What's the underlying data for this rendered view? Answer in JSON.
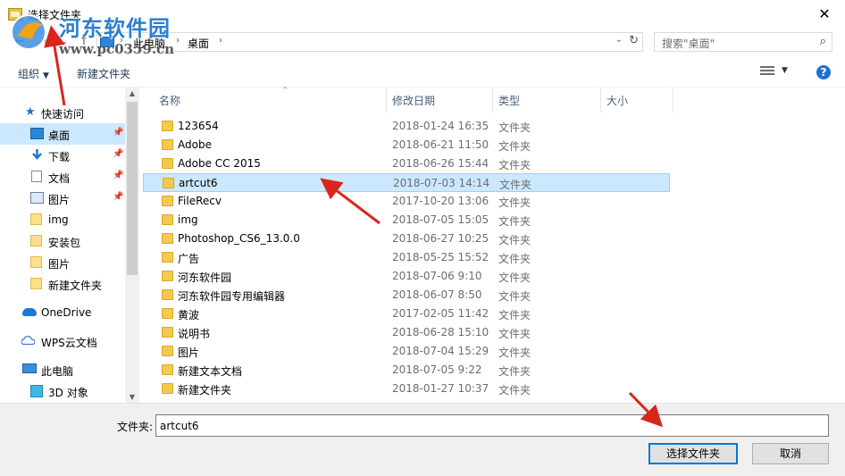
{
  "window": {
    "title": "选择文件夹",
    "close_glyph": "✕"
  },
  "watermark": {
    "text1": "河东软件园",
    "text2": "www.pc0359.cn"
  },
  "address": {
    "back_glyph": "←",
    "forward_glyph": "→",
    "dd_glyph": "⌄",
    "up_glyph": "↑",
    "crumbs": [
      "此电脑",
      "桌面"
    ],
    "sep_glyph": "›",
    "refresh_glyph": "↻"
  },
  "search": {
    "placeholder": "搜索\"桌面\"",
    "icon_glyph": "⌕"
  },
  "toolbar": {
    "organize_label": "组织",
    "organize_caret": "▼",
    "new_folder_label": "新建文件夹",
    "view_caret": "▼",
    "help_glyph": "?"
  },
  "nav": {
    "quick_access": "快速访问",
    "items": [
      {
        "label": "桌面",
        "icon": "desktop-icon",
        "pinned": true
      },
      {
        "label": "下载",
        "icon": "download-icon",
        "pinned": true
      },
      {
        "label": "文档",
        "icon": "document-icon",
        "pinned": true
      },
      {
        "label": "图片",
        "icon": "picture-icon",
        "pinned": true
      },
      {
        "label": "img",
        "icon": "folder-icon",
        "pinned": false
      },
      {
        "label": "安装包",
        "icon": "folder-icon",
        "pinned": false
      },
      {
        "label": "图片",
        "icon": "folder-icon",
        "pinned": false
      },
      {
        "label": "新建文件夹",
        "icon": "folder-icon",
        "pinned": false
      }
    ],
    "onedrive": "OneDrive",
    "wps": "WPS云文档",
    "this_pc": "此电脑",
    "objects_3d": "3D 对象",
    "pin_glyph": "📌"
  },
  "columns": {
    "name": "名称",
    "date": "修改日期",
    "type": "类型",
    "size": "大小",
    "sort_glyph": "^"
  },
  "files": [
    {
      "name": "123654",
      "date": "2018-01-24 16:35",
      "type": "文件夹"
    },
    {
      "name": "Adobe",
      "date": "2018-06-21 11:50",
      "type": "文件夹"
    },
    {
      "name": "Adobe CC 2015",
      "date": "2018-06-26 15:44",
      "type": "文件夹"
    },
    {
      "name": "artcut6",
      "date": "2018-07-03 14:14",
      "type": "文件夹"
    },
    {
      "name": "FileRecv",
      "date": "2017-10-20 13:06",
      "type": "文件夹"
    },
    {
      "name": "img",
      "date": "2018-07-05 15:05",
      "type": "文件夹"
    },
    {
      "name": "Photoshop_CS6_13.0.0",
      "date": "2018-06-27 10:25",
      "type": "文件夹"
    },
    {
      "name": "广告",
      "date": "2018-05-25 15:52",
      "type": "文件夹"
    },
    {
      "name": "河东软件园",
      "date": "2018-07-06 9:10",
      "type": "文件夹"
    },
    {
      "name": "河东软件园专用编辑器",
      "date": "2018-06-07 8:50",
      "type": "文件夹"
    },
    {
      "name": "黄波",
      "date": "2017-02-05 11:42",
      "type": "文件夹"
    },
    {
      "name": "说明书",
      "date": "2018-06-28 15:10",
      "type": "文件夹"
    },
    {
      "name": "图片",
      "date": "2018-07-04 15:29",
      "type": "文件夹"
    },
    {
      "name": "新建文本文档",
      "date": "2018-07-05 9:22",
      "type": "文件夹"
    },
    {
      "name": "新建文件夹",
      "date": "2018-01-27 10:37",
      "type": "文件夹"
    }
  ],
  "selected_index": 3,
  "footer": {
    "folder_label": "文件夹:",
    "folder_value": "artcut6",
    "select_button": "选择文件夹",
    "cancel_button": "取消"
  },
  "colors": {
    "accent": "#0078d7",
    "selection": "#cce8ff",
    "annotation_arrow": "#d9261c"
  }
}
